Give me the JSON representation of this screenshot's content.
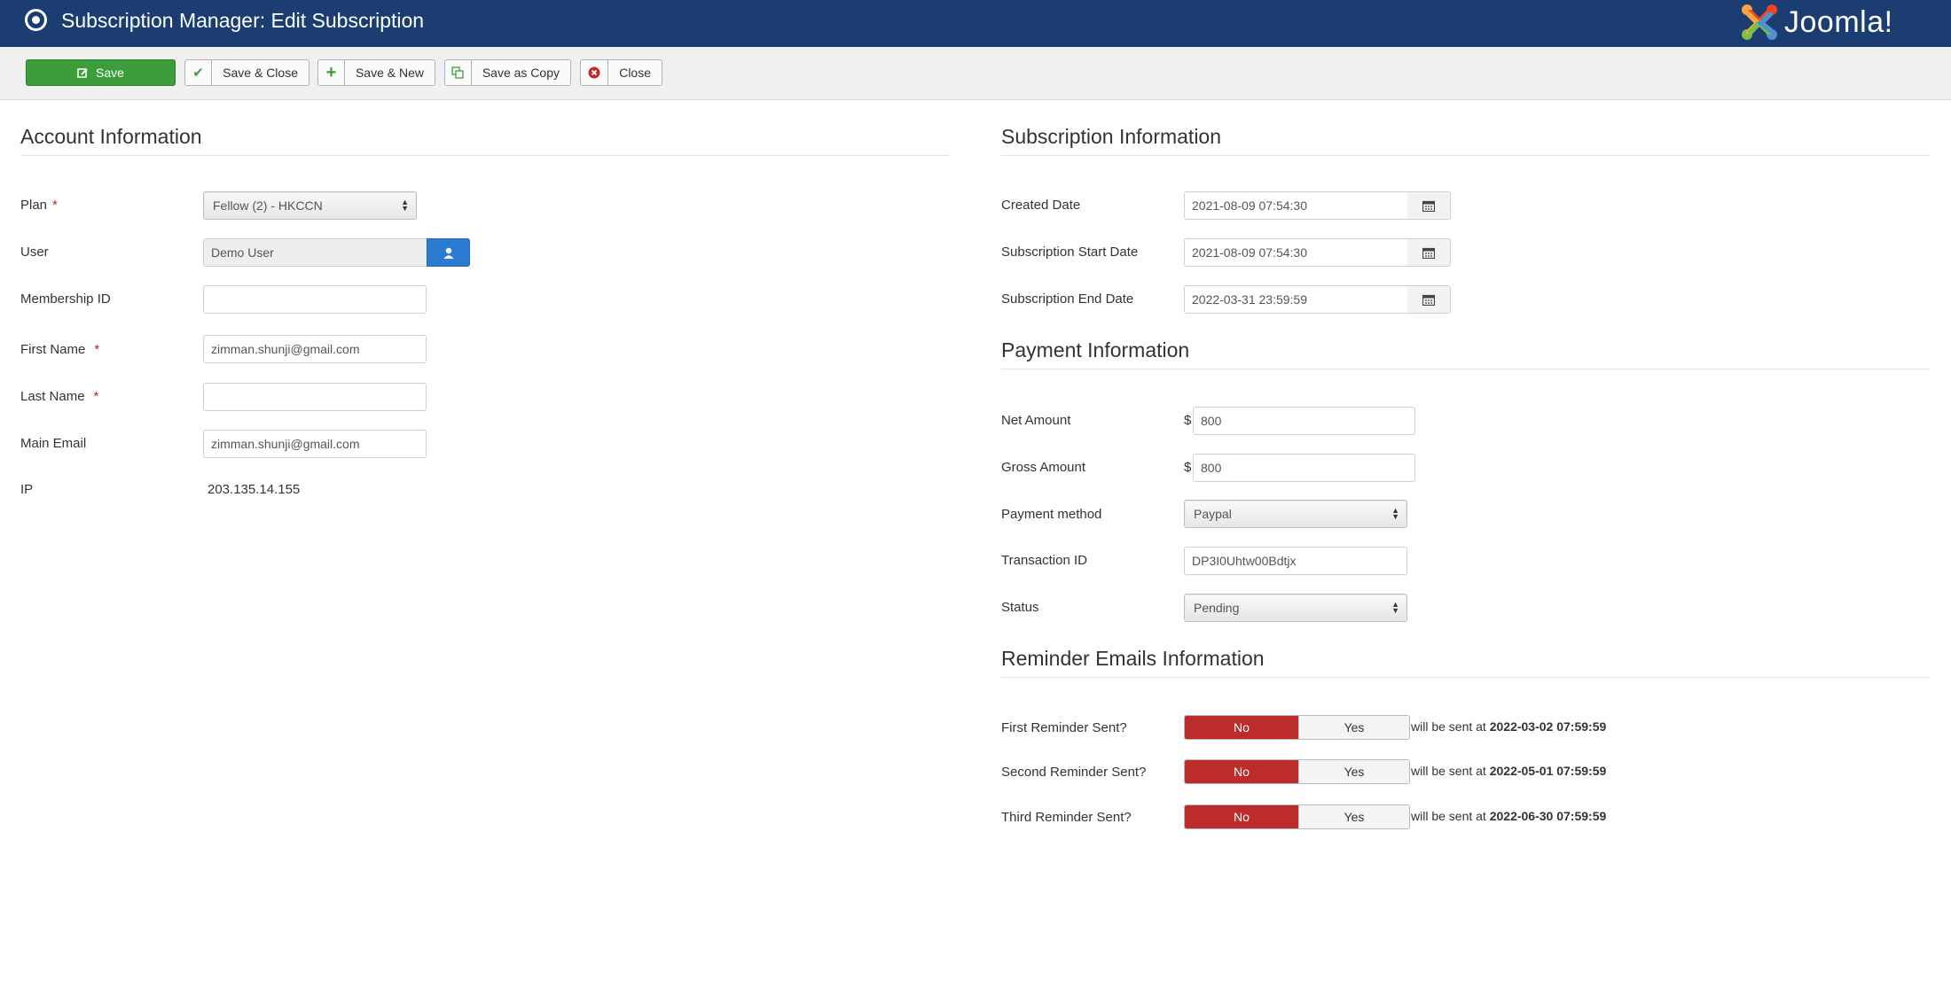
{
  "header": {
    "title": "Subscription Manager: Edit Subscription",
    "logo_text": "Joomla!",
    "background_color": "#1c3d72"
  },
  "toolbar": {
    "save_label": "Save",
    "save_close_label": "Save & Close",
    "save_new_label": "Save & New",
    "save_copy_label": "Save as Copy",
    "close_label": "Close",
    "icons": {
      "save": "edit-icon",
      "save_close": "check-icon",
      "save_new": "plus-icon",
      "save_copy": "copy-icon",
      "close": "close-circle-icon"
    }
  },
  "account": {
    "title": "Account Information",
    "plan_label": "Plan",
    "plan_value": "Fellow (2) - HKCCN",
    "user_label": "User",
    "user_value": "Demo User",
    "membership_label": "Membership ID",
    "membership_value": "",
    "first_name_label": "First Name",
    "first_name_value": "zimman.shunji@gmail.com",
    "last_name_label": "Last Name",
    "last_name_value": "",
    "main_email_label": "Main Email",
    "main_email_value": "zimman.shunji@gmail.com",
    "ip_label": "IP",
    "ip_value": "203.135.14.155",
    "required_marker": "*"
  },
  "subscription": {
    "title": "Subscription Information",
    "created_label": "Created Date",
    "created_value": "2021-08-09 07:54:30",
    "start_label": "Subscription Start Date",
    "start_value": "2021-08-09 07:54:30",
    "end_label": "Subscription End Date",
    "end_value": "2022-03-31 23:59:59"
  },
  "payment": {
    "title": "Payment Information",
    "currency_symbol": "$",
    "net_label": "Net Amount",
    "net_value": "800",
    "gross_label": "Gross Amount",
    "gross_value": "800",
    "method_label": "Payment method",
    "method_value": "Paypal",
    "transaction_label": "Transaction ID",
    "transaction_value": "DP3I0Uhtw00Bdtjx",
    "status_label": "Status",
    "status_value": "Pending"
  },
  "reminders": {
    "title": "Reminder Emails Information",
    "no_label": "No",
    "yes_label": "Yes",
    "note_prefix": "will be sent at",
    "items": [
      {
        "label": "First Reminder Sent?",
        "date": "2022-03-02 07:59:59"
      },
      {
        "label": "Second Reminder Sent?",
        "date": "2022-05-01 07:59:59"
      },
      {
        "label": "Third Reminder Sent?",
        "date": "2022-06-30 07:59:59"
      }
    ]
  },
  "colors": {
    "save_green": "#3b9e3a",
    "toggle_no_red": "#bd2c2c",
    "user_button_blue": "#2a7cd3"
  }
}
